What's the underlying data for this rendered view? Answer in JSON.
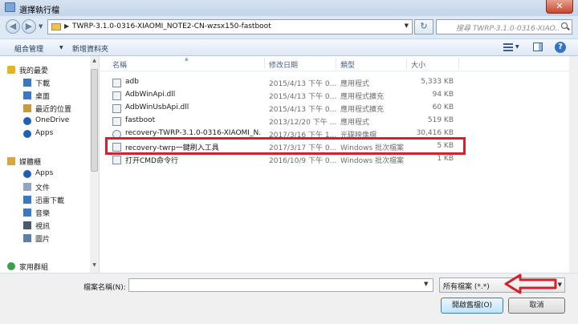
{
  "window": {
    "title": "選擇執行檔",
    "close_glyph": "✕"
  },
  "address": {
    "back_glyph": "◀",
    "forward_glyph": "▶",
    "path": "TWRP-3.1.0-0316-XIAOMI_NOTE2-CN-wzsx150-fastboot",
    "search_placeholder": "搜尋 TWRP-3.1.0-0316-XIAO...",
    "refresh_glyph": "↻"
  },
  "toolbar": {
    "organize_label": "組合管理",
    "new_folder_label": "新增資料夾",
    "help_glyph": "?"
  },
  "nav": {
    "favorites": {
      "label": "我的最愛",
      "icon": "star-icon",
      "color": "#e8b414"
    },
    "favorite_items": [
      {
        "label": "下載",
        "icon": "download-icon",
        "color": "#3a77c4"
      },
      {
        "label": "桌面",
        "icon": "desktop-icon",
        "color": "#3a77c4"
      },
      {
        "label": "最近的位置",
        "icon": "recent-places-icon",
        "color": "#c89a3c"
      },
      {
        "label": "OneDrive",
        "icon": "onedrive-icon",
        "color": "#1f5fb5"
      },
      {
        "label": "Apps",
        "icon": "apps-icon",
        "color": "#1f5fb5"
      }
    ],
    "libraries": {
      "label": "媒體櫃",
      "icon": "library-icon",
      "color": "#d9a63a"
    },
    "library_items": [
      {
        "label": "Apps",
        "icon": "apps-icon",
        "color": "#1f5fb5"
      },
      {
        "label": "文件",
        "icon": "documents-icon",
        "color": "#8fa6c2"
      },
      {
        "label": "迅雷下載",
        "icon": "thunder-download-icon",
        "color": "#3a77c4"
      },
      {
        "label": "音樂",
        "icon": "music-icon",
        "color": "#3a77c4"
      },
      {
        "label": "視訊",
        "icon": "video-icon",
        "color": "#4a5a6c"
      },
      {
        "label": "圖片",
        "icon": "pictures-icon",
        "color": "#5a7fa8"
      }
    ],
    "homegroup": {
      "label": "家用群組",
      "icon": "homegroup-icon",
      "color": "#3aa04a"
    }
  },
  "files": {
    "columns": {
      "name": "名稱",
      "date": "修改日期",
      "type": "類型",
      "size": "大小"
    },
    "rows": [
      {
        "name": "adb",
        "date": "2015/4/13 下午 0...",
        "type": "應用程式",
        "size": "5,333 KB",
        "icon": "exe-icon"
      },
      {
        "name": "AdbWinApi.dll",
        "date": "2015/4/13 下午 0...",
        "type": "應用程式擴充",
        "size": "94 KB",
        "icon": "dll-icon"
      },
      {
        "name": "AdbWinUsbApi.dll",
        "date": "2015/4/13 下午 0...",
        "type": "應用程式擴充",
        "size": "60 KB",
        "icon": "dll-icon"
      },
      {
        "name": "fastboot",
        "date": "2013/12/20 下午 ...",
        "type": "應用程式",
        "size": "519 KB",
        "icon": "exe-icon"
      },
      {
        "name": "recovery-TWRP-3.1.0-0316-XIAOMI_N...",
        "date": "2017/3/16 下午 1...",
        "type": "光碟映像檔",
        "size": "30,416 KB",
        "icon": "disc-image-icon"
      },
      {
        "name": "recovery-twrp一鍵刷入工具",
        "date": "2017/3/17 下午 0...",
        "type": "Windows 批次檔案",
        "size": "5 KB",
        "icon": "batch-file-icon"
      },
      {
        "name": "打开CMD命令行",
        "date": "2016/10/9 下午 0...",
        "type": "Windows 批次檔案",
        "size": "1 KB",
        "icon": "batch-file-icon"
      }
    ]
  },
  "bottom": {
    "filename_label": "檔案名稱(N):",
    "filename_value": "",
    "filter_value": "所有檔案 (*.*)",
    "open_label": "開啟舊檔(O)",
    "cancel_label": "取消"
  },
  "annotations": {
    "highlight_color": "#d0232b",
    "arrow_color": "#d0232b"
  }
}
